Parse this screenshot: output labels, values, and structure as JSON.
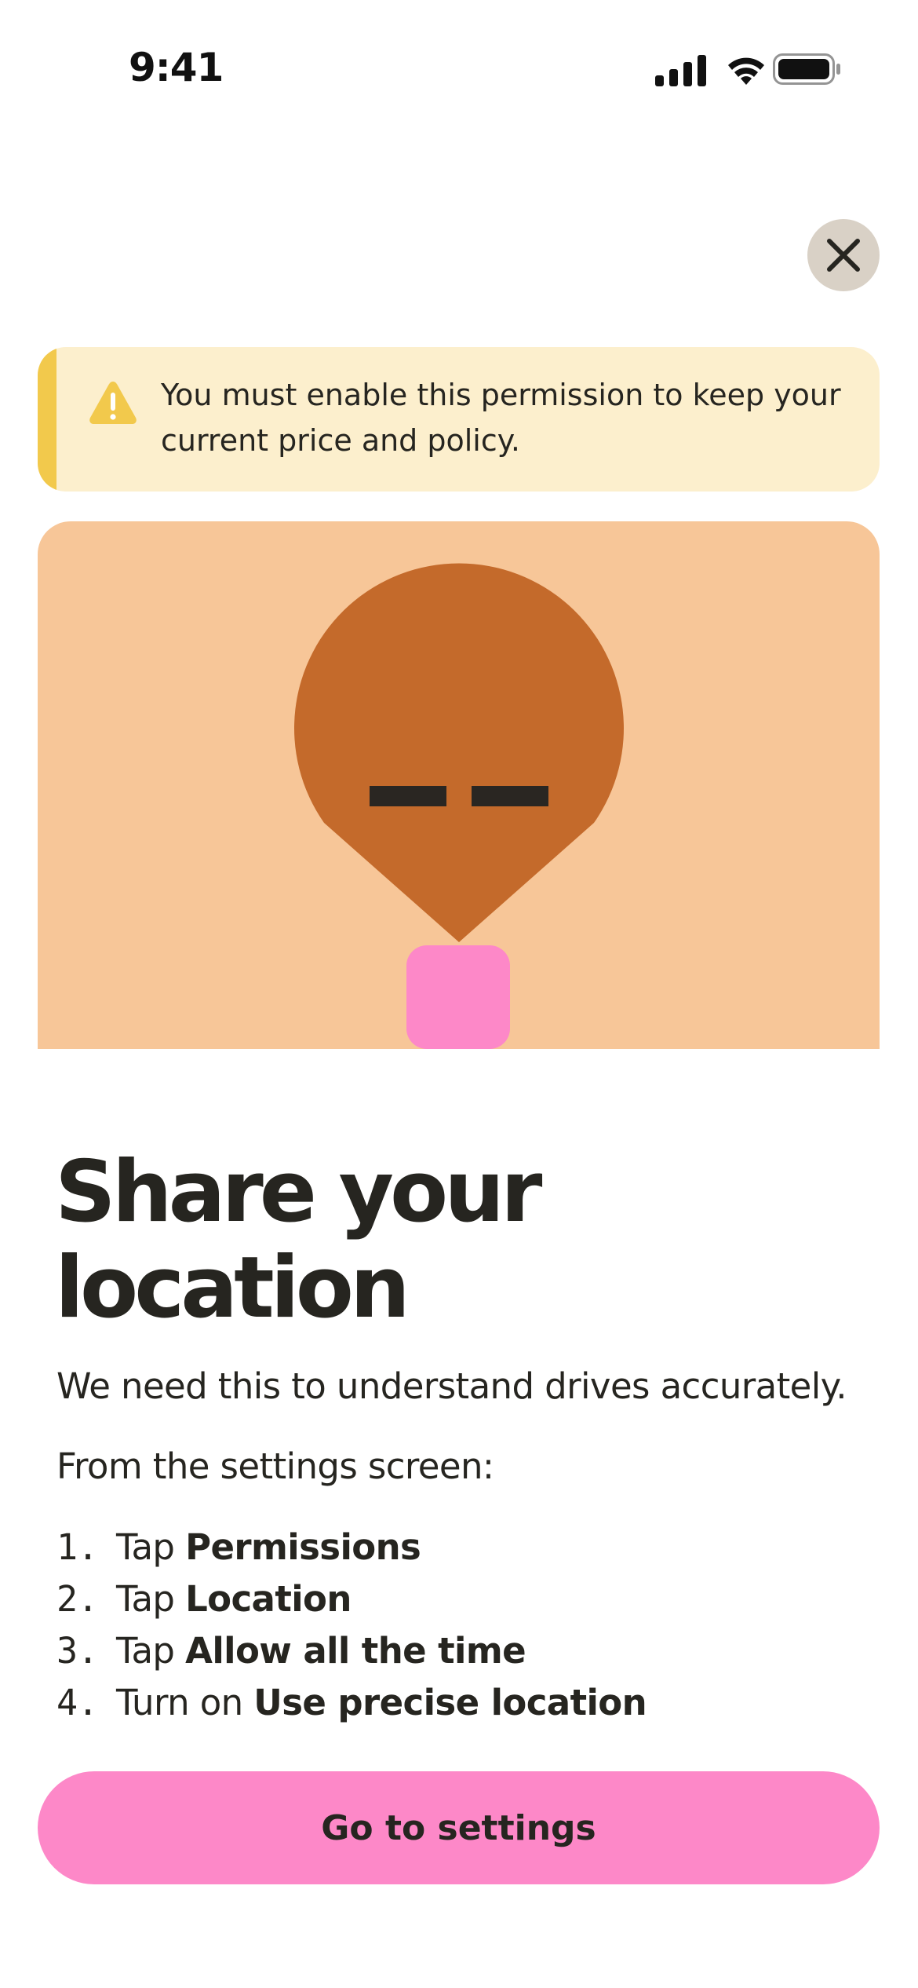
{
  "status_bar": {
    "time": "9:41",
    "icons": [
      "cellular-signal-icon",
      "wifi-icon",
      "battery-icon"
    ]
  },
  "close_button": {
    "icon": "close-icon"
  },
  "banner": {
    "icon": "warning-icon",
    "text": "You must enable this permission  to keep your current price and policy.",
    "accent_color": "#f2c94c",
    "background_color": "#fcefcd"
  },
  "illustration": {
    "description_icon": "location-pin-illustration",
    "background_color": "#f7c698",
    "pin_color": "#c46a2b",
    "base_color": "#fd88c8"
  },
  "content": {
    "title": "Share your location",
    "subtitle": "We need this to understand drives accurately.",
    "intro": "From the settings screen:",
    "steps": [
      {
        "number": "1.",
        "prefix": "Tap ",
        "bold": "Permissions"
      },
      {
        "number": "2.",
        "prefix": "Tap ",
        "bold": "Location"
      },
      {
        "number": "3.",
        "prefix": "Tap ",
        "bold": "Allow all the time"
      },
      {
        "number": "4.",
        "prefix": "Turn on ",
        "bold": "Use precise location"
      }
    ]
  },
  "primary_button": {
    "label": "Go to settings",
    "color": "#fd88c8"
  }
}
